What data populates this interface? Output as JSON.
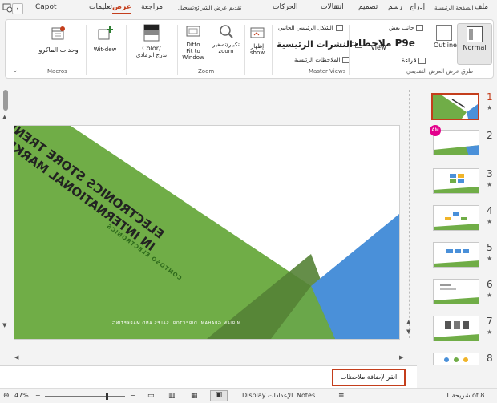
{
  "tabs": {
    "items": [
      {
        "label": "ملف"
      },
      {
        "label": "الصفحة الرئيسية"
      },
      {
        "label": "إدراج"
      },
      {
        "label": "رسم"
      },
      {
        "label": "تصميم"
      },
      {
        "label": "انتقالات"
      },
      {
        "label": "الحركات"
      },
      {
        "label": "تقديم عرض الشرائح"
      },
      {
        "label": "تسجيل"
      },
      {
        "label": "مراجعة"
      },
      {
        "label": "عرض"
      },
      {
        "label": "تعليمات"
      },
      {
        "label": "Capot"
      }
    ],
    "active": "عرض"
  },
  "ribbon": {
    "presentation_views": {
      "group_label": "طرق عرض العرض التقديمي",
      "normal": "Normal",
      "outline_view": "Outline View",
      "slide_sorter": "View",
      "notes_page": "قراءة",
      "reading_view": "جانب بعض",
      "normal_icon": "normal-view-icon"
    },
    "master_views": {
      "group_label": "Master Views",
      "slide_master_big": "ملاحظات P9e",
      "handout_master": "النشرات الرئيسية",
      "notes_master": "الملاحظات الرئيسية",
      "slide_master_small": "الشكل الرئيسي الجانبي"
    },
    "show": {
      "label": "إظهار",
      "sub": "show"
    },
    "zoom": {
      "group_label": "Zoom",
      "zoom_label": "تكبير/تصغير",
      "zoom_sub": "zoom",
      "fit_label": "Ditto",
      "fit_sub": "Fit to",
      "fit_sub2": "Window"
    },
    "color": {
      "label": "Color/",
      "sub": "تدرج الرمادي"
    },
    "window": {
      "label": "Wit-dew"
    },
    "macros": {
      "group_label": "Macros",
      "label": "وحدات الماكرو"
    }
  },
  "slide": {
    "title_line1": "ELECTRONICS STORE TRENDS",
    "title_line2": "IN INTERNATIONAL MARKETS",
    "subtitle": "CONTOSO ELECTRONICS",
    "presenter": "MIRIAM GRAHAM, DIRECTOR, SALES AND MARKETING"
  },
  "thumbnails": {
    "numbers": [
      "1",
      "2",
      "3",
      "4",
      "5",
      "6",
      "7",
      "8"
    ],
    "avatar": "AM"
  },
  "notes": {
    "placeholder": "انقر لإضافة ملاحظات"
  },
  "status": {
    "slide_counter": "شريحة 1 of 8",
    "notes_btn": "Notes",
    "display_btn": "Display الإعدادات",
    "zoom_value": "47%"
  },
  "colors": {
    "accent": "#c43e1c",
    "green": "#70ad47",
    "dark_green": "#548235",
    "blue": "#4a90d9",
    "avatar": "#e3008c"
  }
}
